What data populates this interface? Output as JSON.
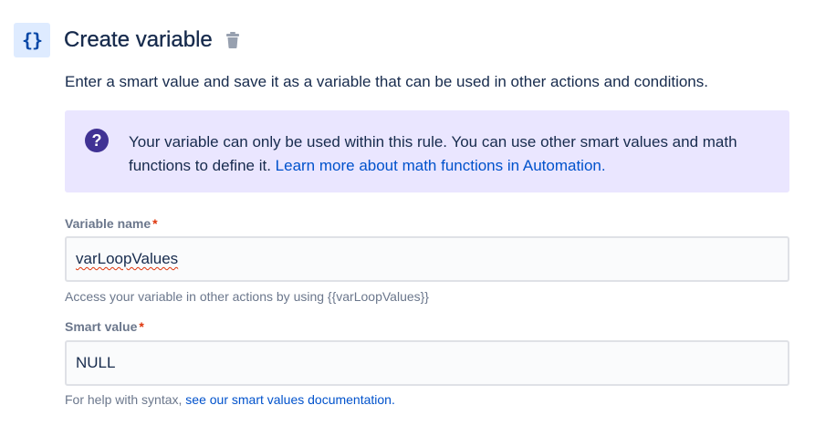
{
  "header": {
    "icon": "curly-braces-icon",
    "icon_text": "{}",
    "title": "Create variable",
    "delete_icon": "trash-icon"
  },
  "description": "Enter a smart value and save it as a variable that can be used in other actions and conditions.",
  "info": {
    "icon": "question-circle-icon",
    "icon_text": "?",
    "text": "Your variable can only be used within this rule. You can use other smart values and math functions to define it. ",
    "link": "Learn more about math functions in Automation."
  },
  "variable_name": {
    "label": "Variable name",
    "required_mark": "*",
    "value": "varLoopValues",
    "helper": "Access your variable in other actions by using {{varLoopValues}}"
  },
  "smart_value": {
    "label": "Smart value",
    "required_mark": "*",
    "value": "NULL",
    "helper_text": "For help with syntax, ",
    "helper_link": "see our smart values documentation."
  },
  "colors": {
    "accent": "#0052cc",
    "info_bg": "#eae6ff",
    "info_icon": "#403294",
    "required": "#de350b"
  }
}
